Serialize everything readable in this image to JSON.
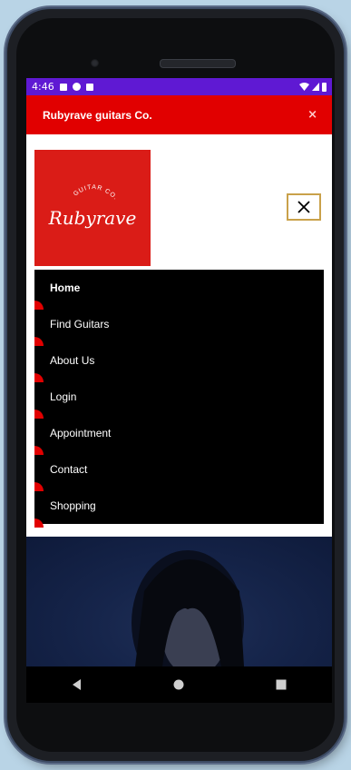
{
  "status_bar": {
    "time": "4:46"
  },
  "app_bar": {
    "title": "Rubyrave guitars Co.",
    "close": "×"
  },
  "logo": {
    "top_text": "GUITAR CO.",
    "script_text": "Rubyrave"
  },
  "menu": {
    "items": [
      {
        "label": "Home",
        "active": true
      },
      {
        "label": "Find Guitars"
      },
      {
        "label": "About Us"
      },
      {
        "label": "Login"
      },
      {
        "label": "Appointment"
      },
      {
        "label": "Contact"
      },
      {
        "label": "Shopping"
      }
    ]
  },
  "colors": {
    "status_bar": "#5f19d3",
    "brand_red": "#e10000",
    "logo_red": "#da1c17",
    "menu_bg": "#000000",
    "toggle_border": "#c9a14a"
  },
  "icons": {
    "status": [
      "notification-a-icon",
      "notification-p-icon",
      "sim-icon",
      "wifi-icon",
      "signal-icon",
      "battery-icon"
    ],
    "menu_toggle": "close-icon",
    "nav_bar": [
      "back-icon",
      "home-icon",
      "recents-icon"
    ]
  }
}
